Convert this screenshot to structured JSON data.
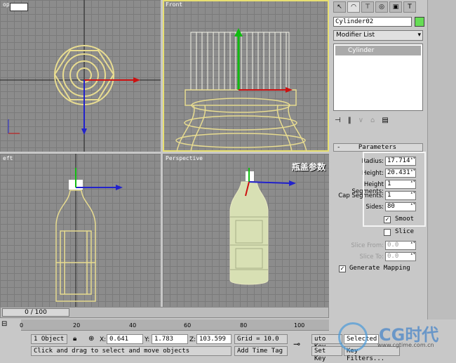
{
  "viewports": {
    "top_label": "op",
    "front_label": "Front",
    "left_label": "eft",
    "persp_label": "Perspective"
  },
  "annotation": "瓶盖参数",
  "panel": {
    "object_name": "Cylinder02",
    "object_color": "#66dd55",
    "modifier_list": "Modifier List",
    "stack_item": "Cylinder",
    "rollout_title": "Parameters",
    "params": [
      {
        "label": "Radius:",
        "value": "17.714"
      },
      {
        "label": "Height:",
        "value": "20.431"
      },
      {
        "label": "Height Segments:",
        "value": "1"
      },
      {
        "label": "Cap Segments:",
        "value": "1"
      },
      {
        "label": "Sides:",
        "value": "80"
      }
    ],
    "smooth": "Smoot",
    "slice": "Slice",
    "slice_from": {
      "label": "Slice From:",
      "value": "0.0"
    },
    "slice_to": {
      "label": "Slice To:",
      "value": "0.0"
    },
    "gen_mapping": "Generate Mapping"
  },
  "timeline": {
    "frame": "0 / 100",
    "ticks": [
      "0",
      "20",
      "40",
      "60",
      "80",
      "100"
    ]
  },
  "status": {
    "selection": "1 Object",
    "x_label": "X:",
    "x": "0.641",
    "y_label": "Y:",
    "y": "1.783",
    "z_label": "Z:",
    "z": "103.599",
    "grid": "Grid = 10.0",
    "prompt": "Click and drag to select and move objects",
    "add_time_tag": "Add Time Tag",
    "auto_key": "uto Key",
    "selected": "Selected",
    "set_key": "Set Key",
    "key_filters": "Key Filters...",
    "watermark": "CG时代",
    "watermark_url": "www.cgtime.com.cn"
  }
}
